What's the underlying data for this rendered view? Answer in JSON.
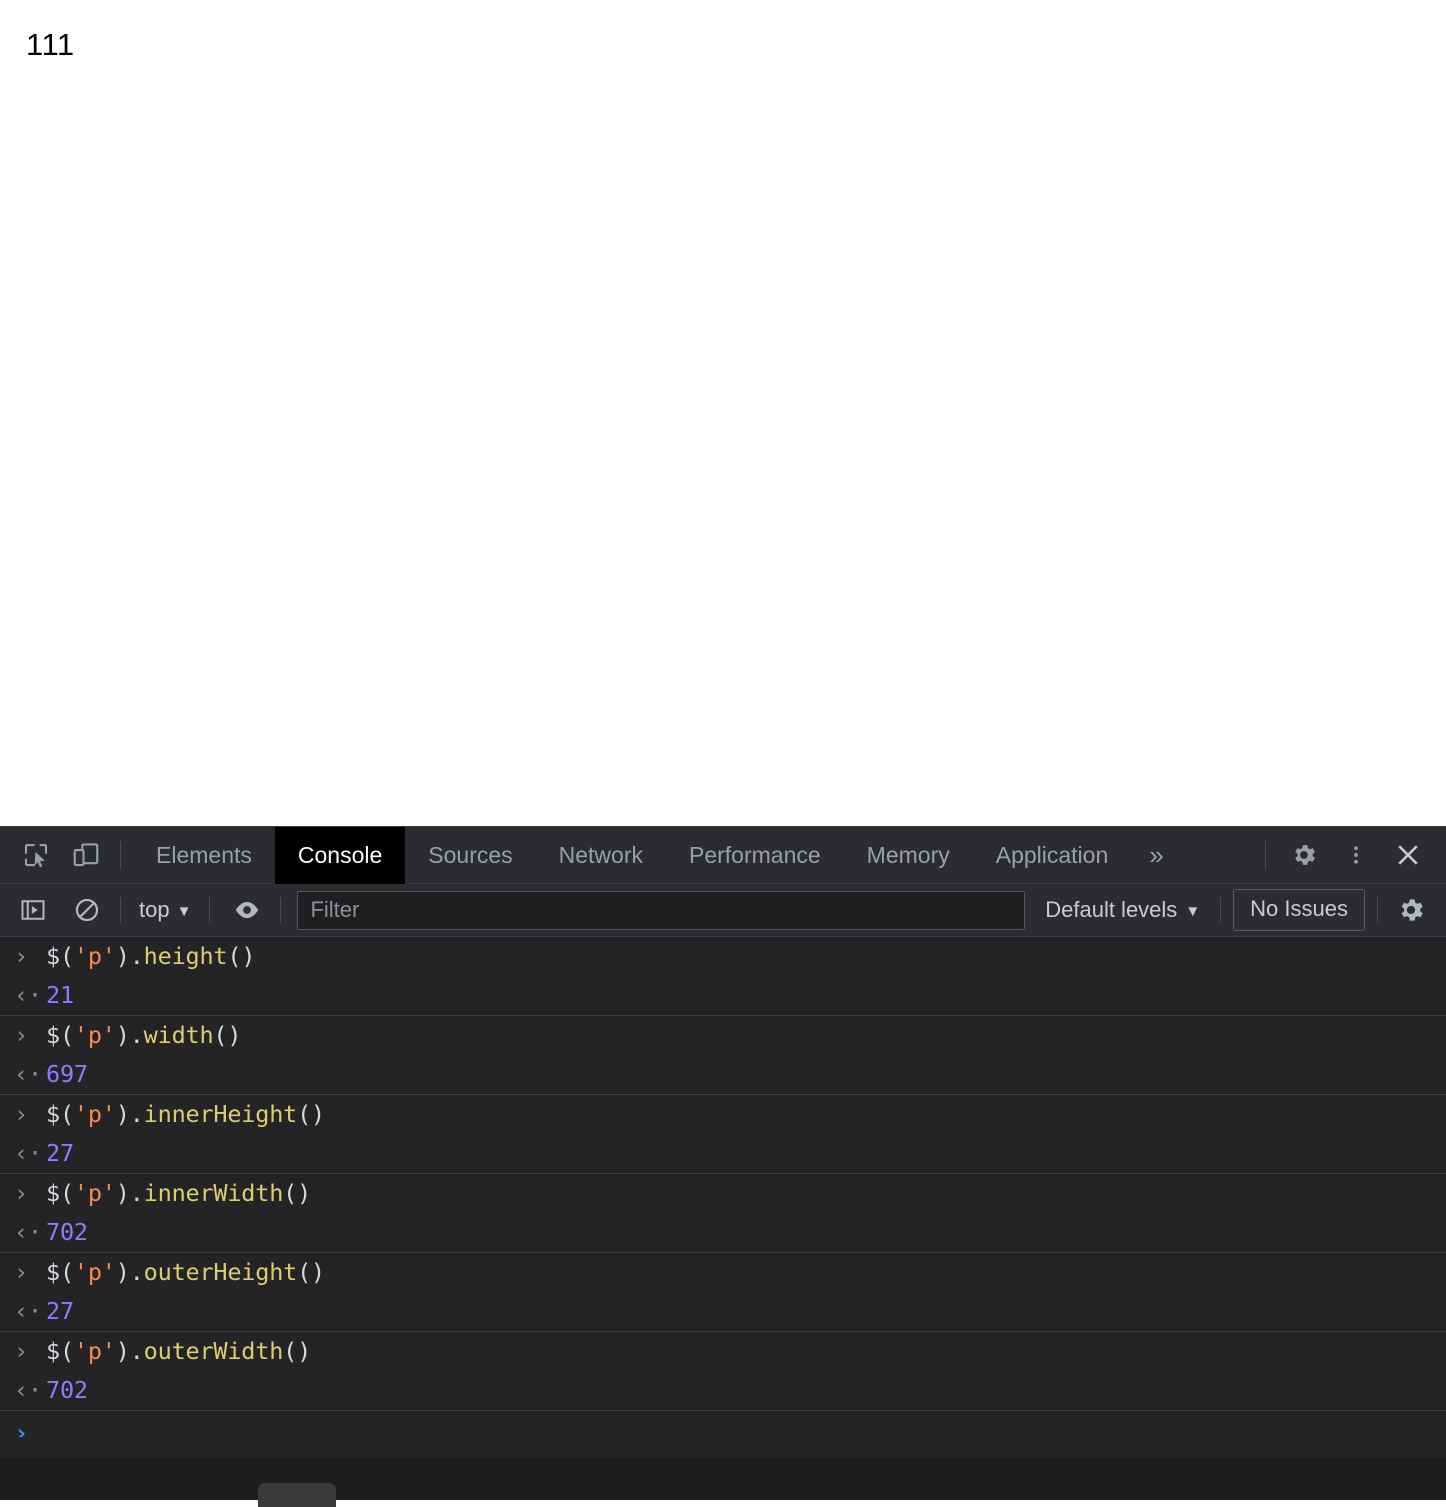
{
  "page": {
    "paragraph_text": "111"
  },
  "devtools": {
    "tabbar": {
      "inspect_icon": "inspect-element-icon",
      "device_icon": "device-toolbar-icon",
      "tabs": [
        {
          "label": "Elements",
          "active": false
        },
        {
          "label": "Console",
          "active": true
        },
        {
          "label": "Sources",
          "active": false
        },
        {
          "label": "Network",
          "active": false
        },
        {
          "label": "Performance",
          "active": false
        },
        {
          "label": "Memory",
          "active": false
        },
        {
          "label": "Application",
          "active": false
        }
      ],
      "more_tabs_label": "»",
      "settings_icon": "gear-icon",
      "more_options_icon": "kebab-menu-icon",
      "close_icon": "close-icon"
    },
    "console_toolbar": {
      "sidebar_toggle_icon": "console-sidebar-toggle-icon",
      "clear_icon": "clear-console-icon",
      "context_label": "top",
      "context_caret": "▼",
      "eye_icon": "live-expression-eye-icon",
      "filter_value": "",
      "filter_placeholder": "Filter",
      "levels_label": "Default levels",
      "levels_caret": "▼",
      "issues_label": "No Issues",
      "settings_icon": "console-settings-gear-icon"
    },
    "console": {
      "input_marker": "›",
      "output_marker": "‹·",
      "prompt_marker": "›",
      "entries": [
        {
          "command_tokens": [
            {
              "text": "$(",
              "type": "plain"
            },
            {
              "text": "'p'",
              "type": "string"
            },
            {
              "text": ").",
              "type": "plain"
            },
            {
              "text": "height",
              "type": "fn"
            },
            {
              "text": "()",
              "type": "plain"
            }
          ],
          "command_text": "$('p').height()",
          "result": "21"
        },
        {
          "command_tokens": [
            {
              "text": "$(",
              "type": "plain"
            },
            {
              "text": "'p'",
              "type": "string"
            },
            {
              "text": ").",
              "type": "plain"
            },
            {
              "text": "width",
              "type": "fn"
            },
            {
              "text": "()",
              "type": "plain"
            }
          ],
          "command_text": "$('p').width()",
          "result": "697"
        },
        {
          "command_tokens": [
            {
              "text": "$(",
              "type": "plain"
            },
            {
              "text": "'p'",
              "type": "string"
            },
            {
              "text": ").",
              "type": "plain"
            },
            {
              "text": "innerHeight",
              "type": "fn"
            },
            {
              "text": "()",
              "type": "plain"
            }
          ],
          "command_text": "$('p').innerHeight()",
          "result": "27"
        },
        {
          "command_tokens": [
            {
              "text": "$(",
              "type": "plain"
            },
            {
              "text": "'p'",
              "type": "string"
            },
            {
              "text": ").",
              "type": "plain"
            },
            {
              "text": "innerWidth",
              "type": "fn"
            },
            {
              "text": "()",
              "type": "plain"
            }
          ],
          "command_text": "$('p').innerWidth()",
          "result": "702"
        },
        {
          "command_tokens": [
            {
              "text": "$(",
              "type": "plain"
            },
            {
              "text": "'p'",
              "type": "string"
            },
            {
              "text": ").",
              "type": "plain"
            },
            {
              "text": "outerHeight",
              "type": "fn"
            },
            {
              "text": "()",
              "type": "plain"
            }
          ],
          "command_text": "$('p').outerHeight()",
          "result": "27"
        },
        {
          "command_tokens": [
            {
              "text": "$(",
              "type": "plain"
            },
            {
              "text": "'p'",
              "type": "string"
            },
            {
              "text": ").",
              "type": "plain"
            },
            {
              "text": "outerWidth",
              "type": "fn"
            },
            {
              "text": "()",
              "type": "plain"
            }
          ],
          "command_text": "$('p').outerWidth()",
          "result": "702"
        }
      ]
    }
  },
  "colors": {
    "page_bg": "#ffffff",
    "devtools_bg": "#242427",
    "toolbar_bg": "#2b2c2f",
    "active_tab_bg": "#000000",
    "text_muted": "#9aa0a6",
    "string_token": "#f28b54",
    "function_token": "#d9d06a",
    "number_token": "#8b7dfb",
    "prompt_blue": "#3b8eea"
  }
}
